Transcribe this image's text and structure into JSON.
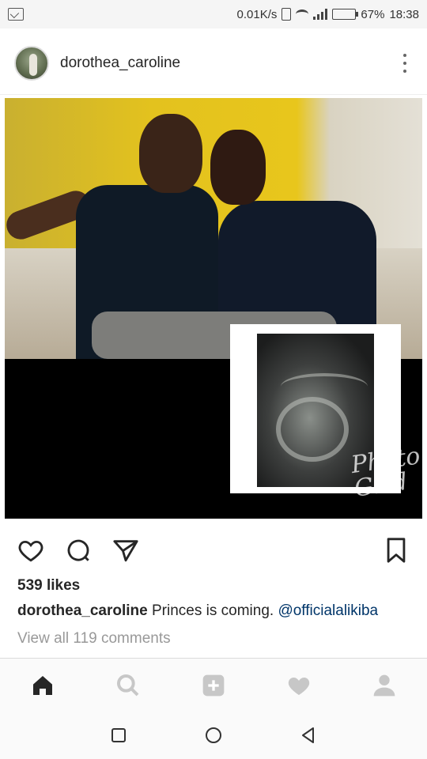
{
  "status_bar": {
    "network_speed": "0.01K/s",
    "battery_percent": "67%",
    "time": "18:38",
    "icons": [
      "screenshot-icon",
      "vibrate-icon",
      "wifi-icon",
      "signal-icon",
      "battery-icon"
    ]
  },
  "post": {
    "username": "dorothea_caroline",
    "watermark_text": "Photo Grid",
    "likes": "539 likes",
    "caption_username": "dorothea_caroline",
    "caption_text": " Princes is coming. ",
    "caption_mention": "@officialalikiba",
    "view_comments": "View all 119 comments"
  },
  "actions": {
    "icons": [
      "heart-icon",
      "comment-icon",
      "share-icon",
      "bookmark-icon"
    ]
  },
  "bottom_nav": {
    "items": [
      "home",
      "search",
      "add",
      "activity",
      "profile"
    ],
    "active": "home"
  },
  "system_nav": {
    "buttons": [
      "recents",
      "home",
      "back"
    ]
  },
  "colors": {
    "mention": "#003569",
    "muted": "#999999",
    "text": "#262626",
    "nav_active": "#262626",
    "nav_inactive": "#c7c7c7"
  }
}
